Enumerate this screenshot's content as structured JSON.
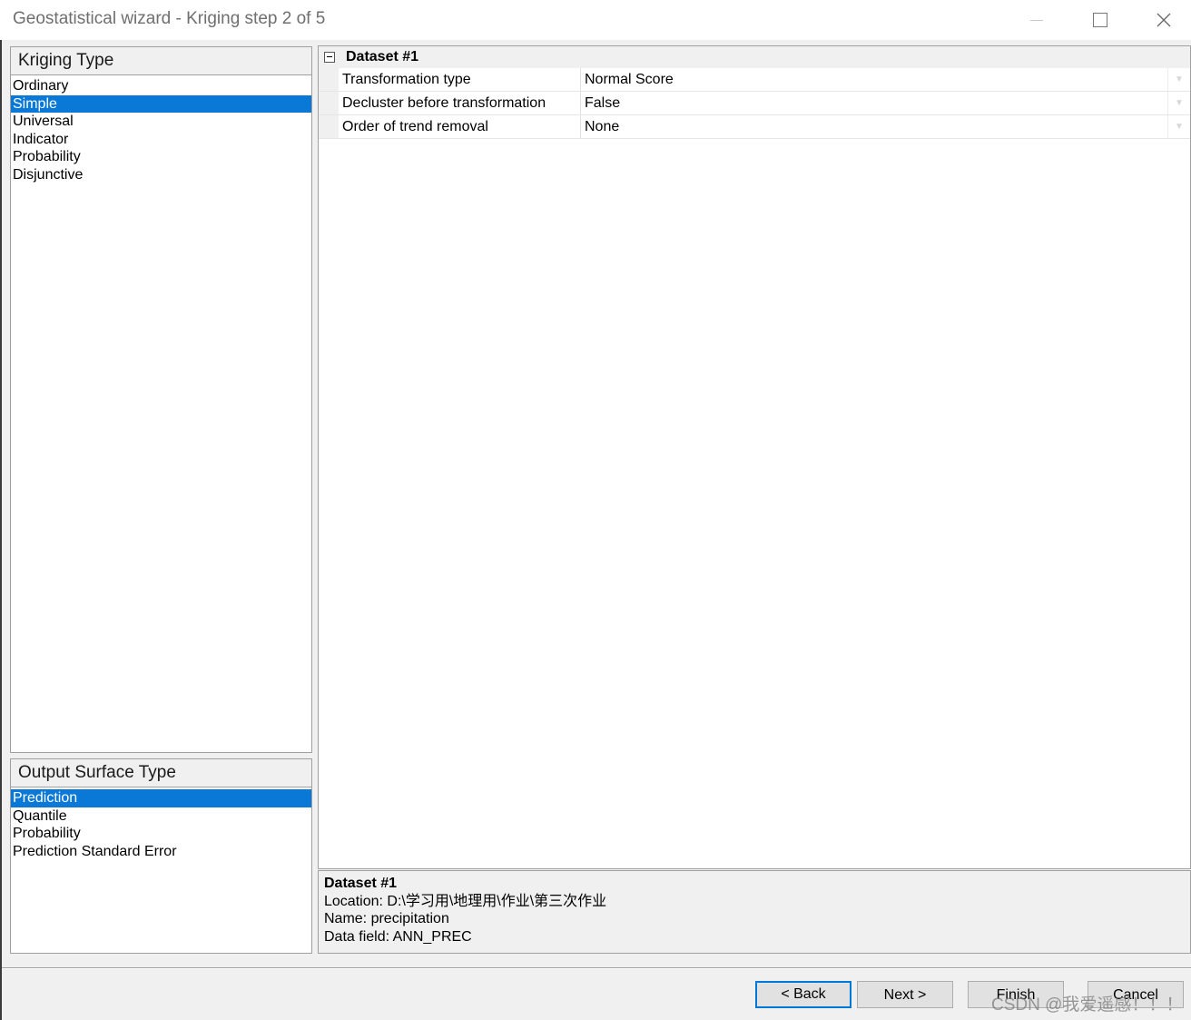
{
  "window": {
    "title": "Geostatistical wizard - Kriging step 2 of 5",
    "controls": [
      "minimize-icon",
      "maximize-icon",
      "close-icon"
    ]
  },
  "kriging_type": {
    "header": "Kriging Type",
    "items": [
      {
        "label": "Ordinary",
        "selected": false
      },
      {
        "label": "Simple",
        "selected": true
      },
      {
        "label": "Universal",
        "selected": false
      },
      {
        "label": "Indicator",
        "selected": false
      },
      {
        "label": "Probability",
        "selected": false
      },
      {
        "label": "Disjunctive",
        "selected": false
      }
    ]
  },
  "output_surface_type": {
    "header": "Output Surface Type",
    "items": [
      {
        "label": "Prediction",
        "selected": true
      },
      {
        "label": "Quantile",
        "selected": false
      },
      {
        "label": "Probability",
        "selected": false
      },
      {
        "label": "Prediction Standard Error",
        "selected": false
      }
    ]
  },
  "property_grid": {
    "category": "Dataset #1",
    "rows": [
      {
        "name": "Transformation type",
        "value": "Normal Score"
      },
      {
        "name": "Decluster before transformation",
        "value": "False"
      },
      {
        "name": "Order of trend removal",
        "value": "None"
      }
    ]
  },
  "info": {
    "title": "Dataset #1",
    "location": "Location: D:\\学习用\\地理用\\作业\\第三次作业",
    "name": "Name: precipitation",
    "data_field": "Data field: ANN_PREC"
  },
  "buttons": {
    "back": "< Back",
    "next": "Next >",
    "finish": "Finish",
    "cancel": "Cancel"
  },
  "watermark": "CSDN @我爱遥感！！！",
  "colors": {
    "selection": "#0a78d7",
    "default_button_border": "#0078d7",
    "client_background": "#f0f0f0"
  }
}
